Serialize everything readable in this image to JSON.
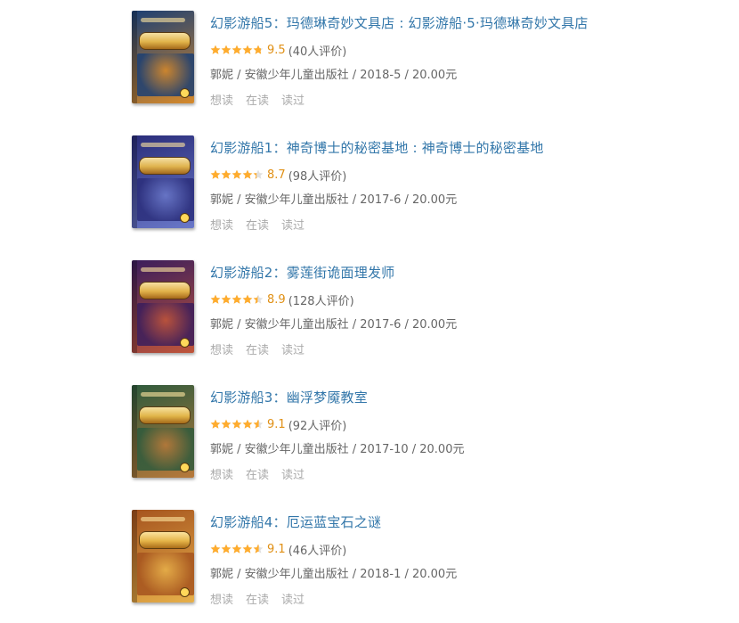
{
  "books": [
    {
      "title": "幻影游船5：玛德琳奇妙文具店 : 幻影游船·5·玛德琳奇妙文具店",
      "score": "9.5",
      "rating_fraction": 0.95,
      "count": "(40人评价)",
      "pub": "郭妮 / 安徽少年儿童出版社 / 2018-5 / 20.00元",
      "cover_colors": [
        "#1c3f73",
        "#d6892a"
      ],
      "actions": [
        "想读",
        "在读",
        "读过"
      ]
    },
    {
      "title": "幻影游船1：神奇博士的秘密基地 : 神奇博士的秘密基地",
      "score": "8.7",
      "rating_fraction": 0.87,
      "count": "(98人评价)",
      "pub": "郭妮 / 安徽少年儿童出版社 / 2017-6 / 20.00元",
      "cover_colors": [
        "#2a2d7a",
        "#6a78c9"
      ],
      "actions": [
        "想读",
        "在读",
        "读过"
      ]
    },
    {
      "title": "幻影游船2：雾莲街诡面理发师",
      "score": "8.9",
      "rating_fraction": 0.89,
      "count": "(128人评价)",
      "pub": "郭妮 / 安徽少年儿童出版社 / 2017-6 / 20.00元",
      "cover_colors": [
        "#3a1d5c",
        "#c0553a"
      ],
      "actions": [
        "想读",
        "在读",
        "读过"
      ]
    },
    {
      "title": "幻影游船3：幽浮梦魇教室",
      "score": "9.1",
      "rating_fraction": 0.91,
      "count": "(92人评价)",
      "pub": "郭妮 / 安徽少年儿童出版社 / 2017-10 / 20.00元",
      "cover_colors": [
        "#2e5a3c",
        "#b8793a"
      ],
      "actions": [
        "想读",
        "在读",
        "读过"
      ]
    },
    {
      "title": "幻影游船4：厄运蓝宝石之谜",
      "score": "9.1",
      "rating_fraction": 0.91,
      "count": "(46人评价)",
      "pub": "郭妮 / 安徽少年儿童出版社 / 2018-1 / 20.00元",
      "cover_colors": [
        "#a5531e",
        "#e7b04a"
      ],
      "actions": [
        "想读",
        "在读",
        "读过"
      ]
    }
  ],
  "colors": {
    "title_link": "#3377aa",
    "star": "#ffac2d",
    "star_empty": "#e0e0e0",
    "meta": "#666666",
    "action": "#aaaaaa"
  }
}
